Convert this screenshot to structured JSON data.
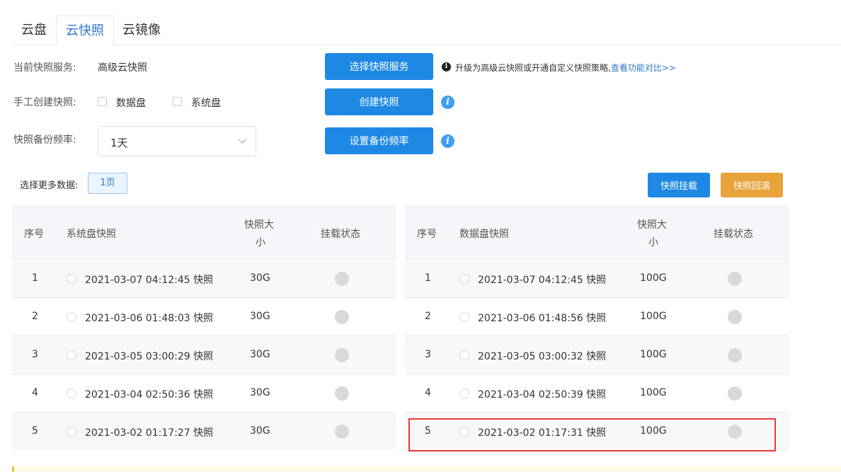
{
  "tabs": [
    "云盘",
    "云快照",
    "云镜像"
  ],
  "active_tab": 1,
  "current_service": {
    "label": "当前快照服务:",
    "value": "高级云快照",
    "button": "选择快照服务",
    "tip_text": "升级为高级云快照或开通自定义快照策略,",
    "tip_link": "查看功能对比>>"
  },
  "manual_create": {
    "label": "手工创建快照:",
    "option_data": "数据盘",
    "option_system": "系统盘",
    "button": "创建快照"
  },
  "backup_freq": {
    "label": "快照备份频率:",
    "selected": "1天",
    "button": "设置备份频率"
  },
  "more_data": {
    "label": "选择更多数据:",
    "page_button": "1页"
  },
  "actions": {
    "mount": "快照挂载",
    "rollback": "快照回滚"
  },
  "system_table": {
    "headers": {
      "index": "序号",
      "name": "系统盘快照",
      "size_l1": "快照大",
      "size_l2": "小",
      "status": "挂载状态"
    },
    "rows": [
      {
        "index": "1",
        "name": "2021-03-07 04:12:45 快照",
        "size": "30G"
      },
      {
        "index": "2",
        "name": "2021-03-06 01:48:03 快照",
        "size": "30G"
      },
      {
        "index": "3",
        "name": "2021-03-05 03:00:29 快照",
        "size": "30G"
      },
      {
        "index": "4",
        "name": "2021-03-04 02:50:36 快照",
        "size": "30G"
      },
      {
        "index": "5",
        "name": "2021-03-02 01:17:27 快照",
        "size": "30G"
      }
    ]
  },
  "data_table": {
    "headers": {
      "index": "序号",
      "name": "数据盘快照",
      "size_l1": "快照大",
      "size_l2": "小",
      "status": "挂载状态"
    },
    "rows": [
      {
        "index": "1",
        "name": "2021-03-07 04:12:45 快照",
        "size": "100G"
      },
      {
        "index": "2",
        "name": "2021-03-06 01:48:56 快照",
        "size": "100G"
      },
      {
        "index": "3",
        "name": "2021-03-05 03:00:32 快照",
        "size": "100G"
      },
      {
        "index": "4",
        "name": "2021-03-04 02:50:39 快照",
        "size": "100G"
      },
      {
        "index": "5",
        "name": "2021-03-02 01:17:31 快照",
        "size": "100G"
      }
    ]
  },
  "colors": {
    "primary": "#1e88e5",
    "orange": "#e8a33a",
    "highlight": "#e53935",
    "link": "#2f77c9"
  }
}
